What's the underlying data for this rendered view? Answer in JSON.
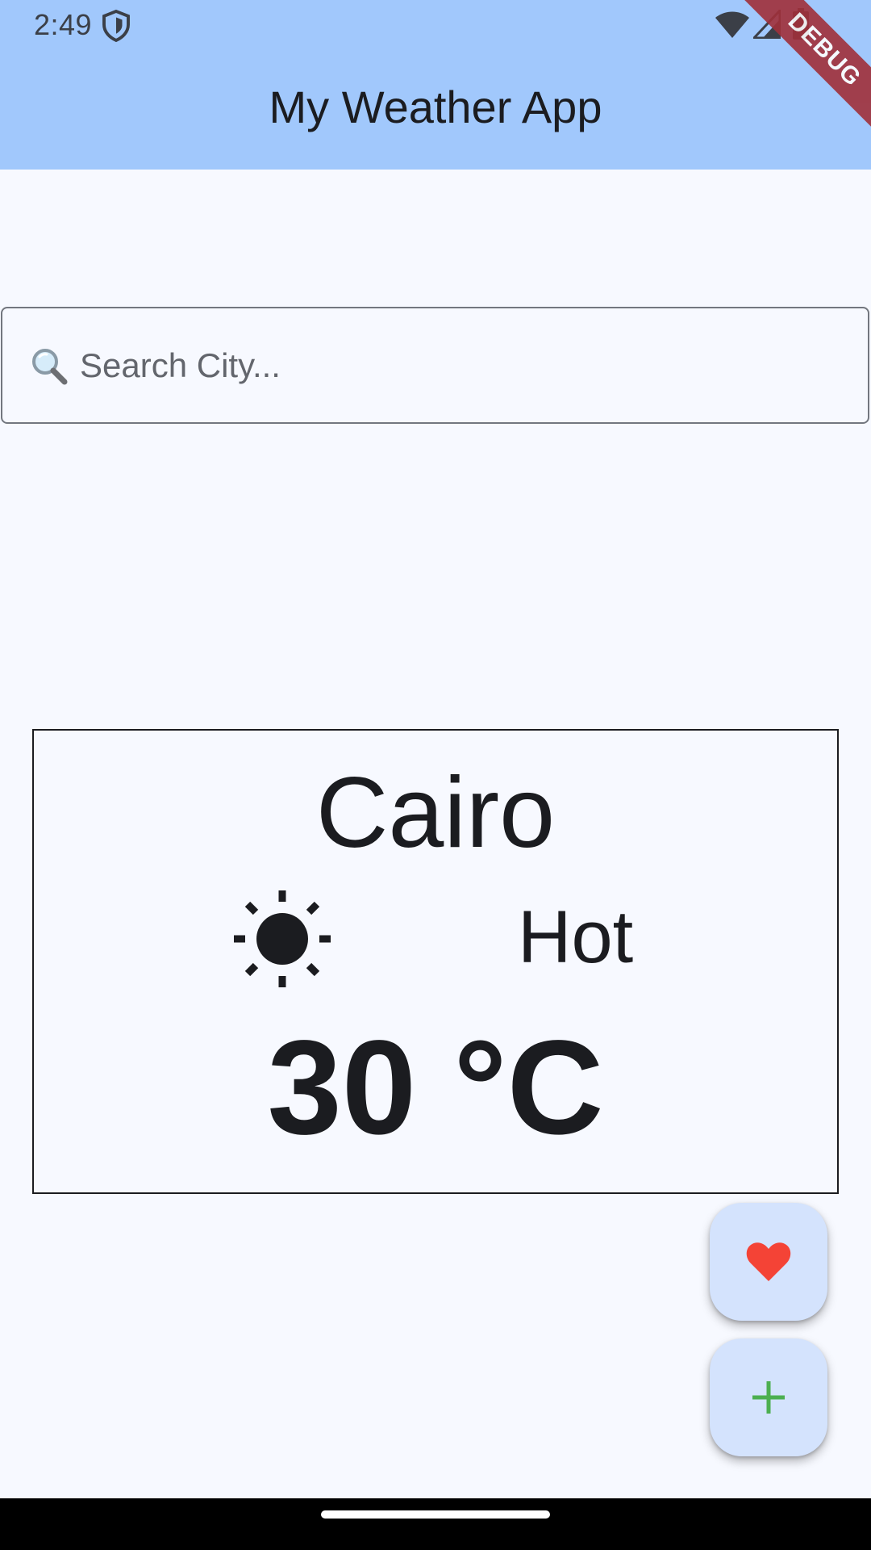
{
  "status_bar": {
    "time": "2:49"
  },
  "app_bar": {
    "title": "My Weather App"
  },
  "debug_banner": {
    "label": "DEBUG"
  },
  "search": {
    "placeholder": "Search City..."
  },
  "weather": {
    "city": "Cairo",
    "condition": "Hot",
    "temperature": "30 °C",
    "condition_icon": "sun-icon"
  },
  "fabs": [
    {
      "name": "favorite-button",
      "icon": "heart-icon",
      "icon_color": "#f44336"
    },
    {
      "name": "add-button",
      "icon": "plus-icon",
      "icon_color": "#4caf50"
    }
  ],
  "colors": {
    "app_bar": "#a1c8fc",
    "background": "#f7f9ff",
    "fab_background": "#d4e3fd",
    "debug_ribbon": "#a0303a"
  }
}
